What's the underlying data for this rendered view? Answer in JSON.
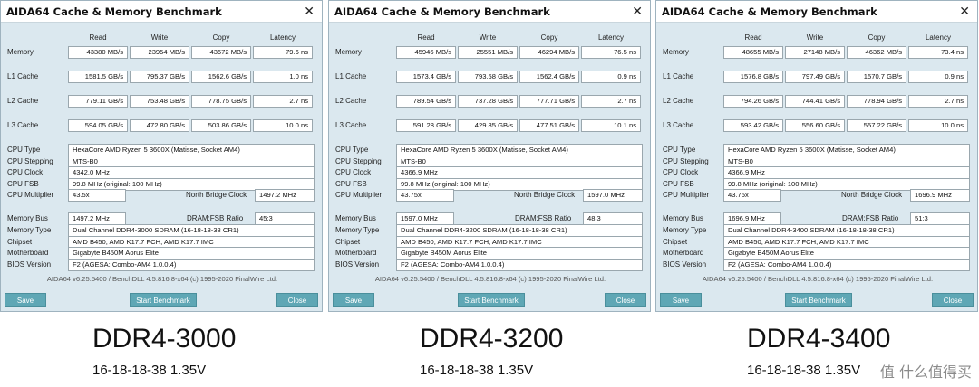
{
  "columns": [
    "Read",
    "Write",
    "Copy",
    "Latency"
  ],
  "row_labels": [
    "Memory",
    "L1 Cache",
    "L2 Cache",
    "L3 Cache"
  ],
  "info_labels": [
    "CPU Type",
    "CPU Stepping",
    "CPU Clock",
    "CPU FSB",
    "CPU Multiplier"
  ],
  "north_bridge_label": "North Bridge Clock",
  "mem_labels": [
    "Memory Bus",
    "Memory Type",
    "Chipset",
    "Motherboard",
    "BIOS Version"
  ],
  "dram_ratio_label": "DRAM:FSB Ratio",
  "buttons": {
    "save": "Save",
    "start": "Start Benchmark",
    "close": "Close"
  },
  "panels": [
    {
      "title": "AIDA64 Cache & Memory Benchmark",
      "rows": [
        [
          "43380 MB/s",
          "23954 MB/s",
          "43672 MB/s",
          "79.6 ns"
        ],
        [
          "1581.5 GB/s",
          "795.37 GB/s",
          "1562.6 GB/s",
          "1.0 ns"
        ],
        [
          "779.11 GB/s",
          "753.48 GB/s",
          "778.75 GB/s",
          "2.7 ns"
        ],
        [
          "594.05 GB/s",
          "472.80 GB/s",
          "503.86 GB/s",
          "10.0 ns"
        ]
      ],
      "cpu_type": "HexaCore AMD Ryzen 5 3600X  (Matisse, Socket AM4)",
      "cpu_stepping": "MTS-B0",
      "cpu_clock": "4342.0 MHz",
      "cpu_fsb": "99.8 MHz  (original: 100 MHz)",
      "cpu_multiplier": "43.5x",
      "north_bridge": "1497.2 MHz",
      "memory_bus": "1497.2 MHz",
      "dram_ratio": "45:3",
      "memory_type": "Dual Channel DDR4-3000 SDRAM  (16-18-18-38 CR1)",
      "chipset": "AMD B450, AMD K17.7 FCH, AMD K17.7 IMC",
      "motherboard": "Gigabyte B450M Aorus Elite",
      "bios": "F2  (AGESA: Combo-AM4 1.0.0.4)",
      "footer": "AIDA64 v6.25.5400 / BenchDLL 4.5.816.8-x64  (c) 1995-2020 FinalWire Ltd."
    },
    {
      "title": "AIDA64 Cache & Memory Benchmark",
      "rows": [
        [
          "45946 MB/s",
          "25551 MB/s",
          "46294 MB/s",
          "76.5 ns"
        ],
        [
          "1573.4 GB/s",
          "793.58 GB/s",
          "1562.4 GB/s",
          "0.9 ns"
        ],
        [
          "789.54 GB/s",
          "737.28 GB/s",
          "777.71 GB/s",
          "2.7 ns"
        ],
        [
          "591.28 GB/s",
          "429.85 GB/s",
          "477.51 GB/s",
          "10.1 ns"
        ]
      ],
      "cpu_type": "HexaCore AMD Ryzen 5 3600X  (Matisse, Socket AM4)",
      "cpu_stepping": "MTS-B0",
      "cpu_clock": "4366.9 MHz",
      "cpu_fsb": "99.8 MHz  (original: 100 MHz)",
      "cpu_multiplier": "43.75x",
      "north_bridge": "1597.0 MHz",
      "memory_bus": "1597.0 MHz",
      "dram_ratio": "48:3",
      "memory_type": "Dual Channel DDR4-3200 SDRAM  (16-18-18-38 CR1)",
      "chipset": "AMD B450, AMD K17.7 FCH, AMD K17.7 IMC",
      "motherboard": "Gigabyte B450M Aorus Elite",
      "bios": "F2  (AGESA: Combo-AM4 1.0.0.4)",
      "footer": "AIDA64 v6.25.5400 / BenchDLL 4.5.816.8-x64  (c) 1995-2020 FinalWire Ltd."
    },
    {
      "title": "AIDA64 Cache & Memory Benchmark",
      "rows": [
        [
          "48655 MB/s",
          "27148 MB/s",
          "46362 MB/s",
          "73.4 ns"
        ],
        [
          "1576.8 GB/s",
          "797.49 GB/s",
          "1570.7 GB/s",
          "0.9 ns"
        ],
        [
          "794.26 GB/s",
          "744.41 GB/s",
          "778.94 GB/s",
          "2.7 ns"
        ],
        [
          "593.42 GB/s",
          "556.60 GB/s",
          "557.22 GB/s",
          "10.0 ns"
        ]
      ],
      "cpu_type": "HexaCore AMD Ryzen 5 3600X  (Matisse, Socket AM4)",
      "cpu_stepping": "MTS-B0",
      "cpu_clock": "4366.9 MHz",
      "cpu_fsb": "99.8 MHz  (original: 100 MHz)",
      "cpu_multiplier": "43.75x",
      "north_bridge": "1696.9 MHz",
      "memory_bus": "1696.9 MHz",
      "dram_ratio": "51:3",
      "memory_type": "Dual Channel DDR4-3400 SDRAM  (16-18-18-38 CR1)",
      "chipset": "AMD B450, AMD K17.7 FCH, AMD K17.7 IMC",
      "motherboard": "Gigabyte B450M Aorus Elite",
      "bios": "F2  (AGESA: Combo-AM4 1.0.0.4)",
      "footer": "AIDA64 v6.25.5400 / BenchDLL 4.5.816.8-x64  (c) 1995-2020 FinalWire Ltd."
    }
  ],
  "captions": [
    {
      "title": "DDR4-3000",
      "sub": "16-18-18-38 1.35V"
    },
    {
      "title": "DDR4-3200",
      "sub": "16-18-18-38 1.35V"
    },
    {
      "title": "DDR4-3400",
      "sub": "16-18-18-38 1.35V"
    }
  ],
  "watermark": "值 什么值得买",
  "colors": {
    "window_bg": "#dbe8ef",
    "button": "#5fa7b5"
  }
}
